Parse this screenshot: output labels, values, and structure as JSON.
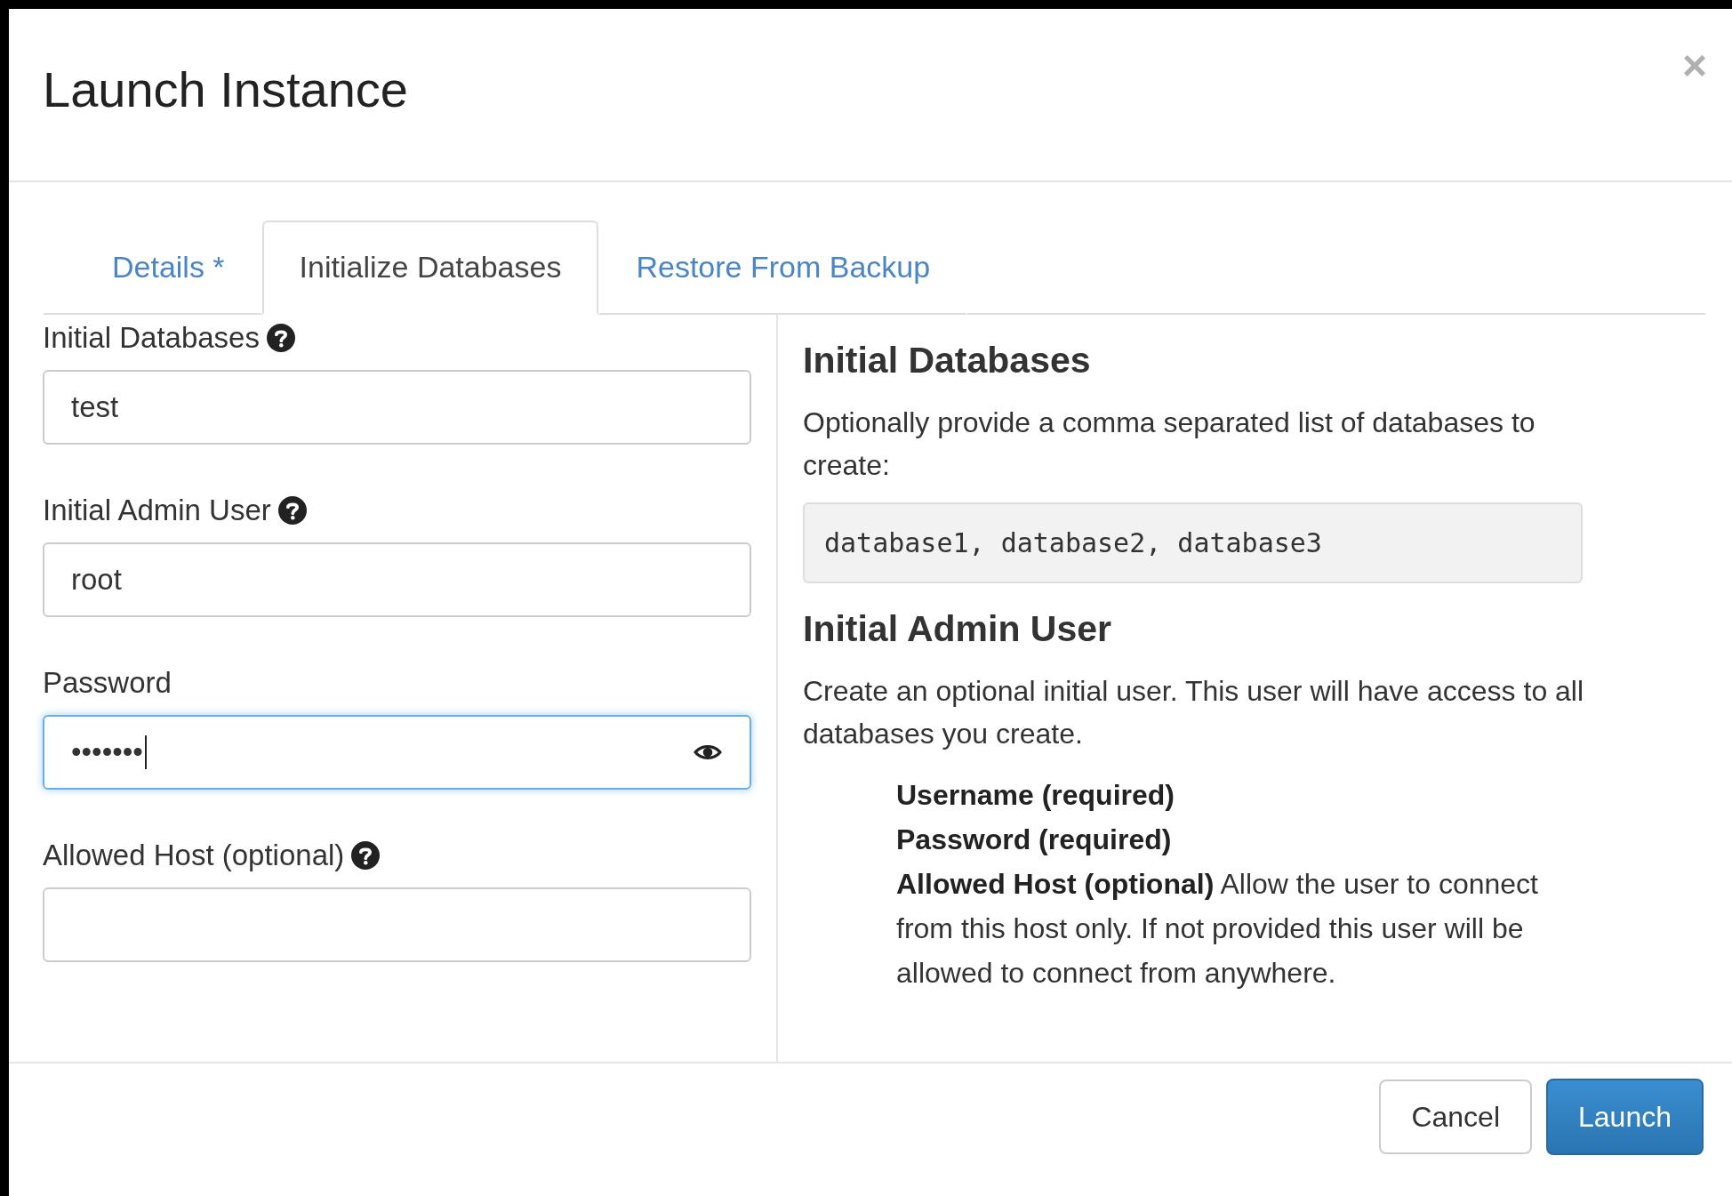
{
  "dialog": {
    "title": "Launch Instance",
    "close": "×"
  },
  "tabs": [
    {
      "label": "Details *",
      "selected": false
    },
    {
      "label": "Initialize Databases",
      "selected": true
    },
    {
      "label": "Restore From Backup",
      "selected": false
    }
  ],
  "fields": [
    {
      "label": "Initial Databases",
      "help": true,
      "value": "test",
      "focused": false,
      "reveal": false
    },
    {
      "label": "Initial Admin User",
      "help": true,
      "value": "root",
      "focused": false,
      "reveal": false
    },
    {
      "label": "Password",
      "help": false,
      "value": "•••••••",
      "focused": true,
      "reveal": true
    },
    {
      "label": "Allowed Host (optional)",
      "help": true,
      "focused": false,
      "reveal": false
    }
  ],
  "help_panel": {
    "sections": [
      {
        "heading": "Initial Databases",
        "text": "Optionally provide a comma separated list of databases to create:",
        "code": "database1, database2, database3"
      },
      {
        "heading": "Initial Admin User",
        "text": "Create an optional initial user. This user will have access to all databases you create.",
        "items": [
          "**Username (required)**",
          "**Password (required)**",
          "**Allowed Host (optional)** Allow the user to connect from this host only. If not provided this user will be allowed to connect from anywhere."
        ]
      }
    ]
  },
  "buttons": [
    {
      "label": "Cancel",
      "kind": "default"
    },
    {
      "label": "Launch",
      "kind": "primary"
    }
  ]
}
